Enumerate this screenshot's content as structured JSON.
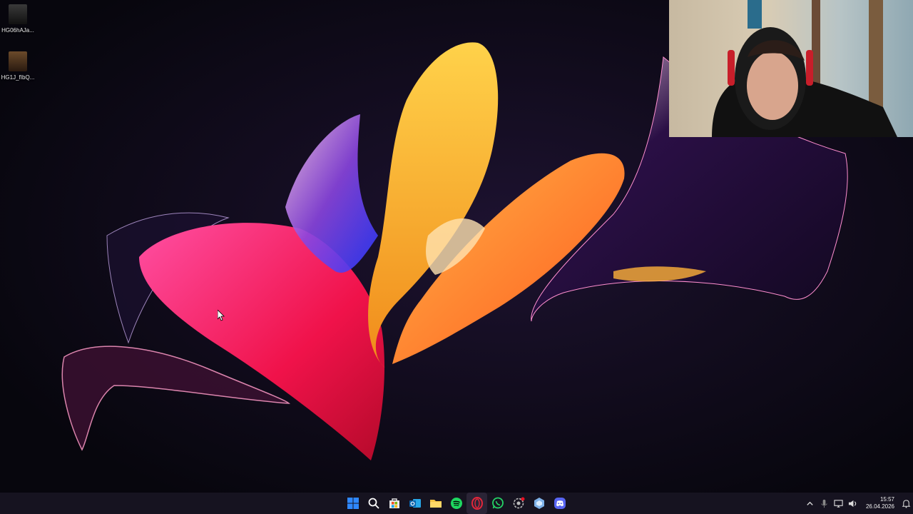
{
  "desktop": {
    "icons": [
      {
        "label": "HG06hAJa...",
        "icon": "game-thumbnail-icon"
      },
      {
        "label": "HG1J_fIbQ...",
        "icon": "game-thumbnail-icon"
      }
    ]
  },
  "taskbar": {
    "pinned": [
      {
        "name": "start-button",
        "icon": "windows-logo-icon"
      },
      {
        "name": "search-button",
        "icon": "search-icon"
      },
      {
        "name": "microsoft-store",
        "icon": "store-icon"
      },
      {
        "name": "outlook",
        "icon": "outlook-icon"
      },
      {
        "name": "file-explorer",
        "icon": "folder-icon"
      },
      {
        "name": "spotify",
        "icon": "spotify-icon"
      },
      {
        "name": "opera-gx",
        "icon": "opera-icon"
      },
      {
        "name": "whatsapp",
        "icon": "whatsapp-icon"
      },
      {
        "name": "app-with-notification",
        "icon": "settings-gear-icon"
      },
      {
        "name": "app-blue",
        "icon": "app-icon"
      },
      {
        "name": "discord",
        "icon": "discord-icon"
      }
    ],
    "clock": {
      "time": "15:57",
      "date": "26.04.2026"
    }
  },
  "colors": {
    "accent_start": "#2f88ff",
    "spotify": "#1ed760",
    "opera": "#e2263a",
    "whatsapp": "#25d366",
    "discord": "#5865f2",
    "folder": "#f6c343"
  }
}
